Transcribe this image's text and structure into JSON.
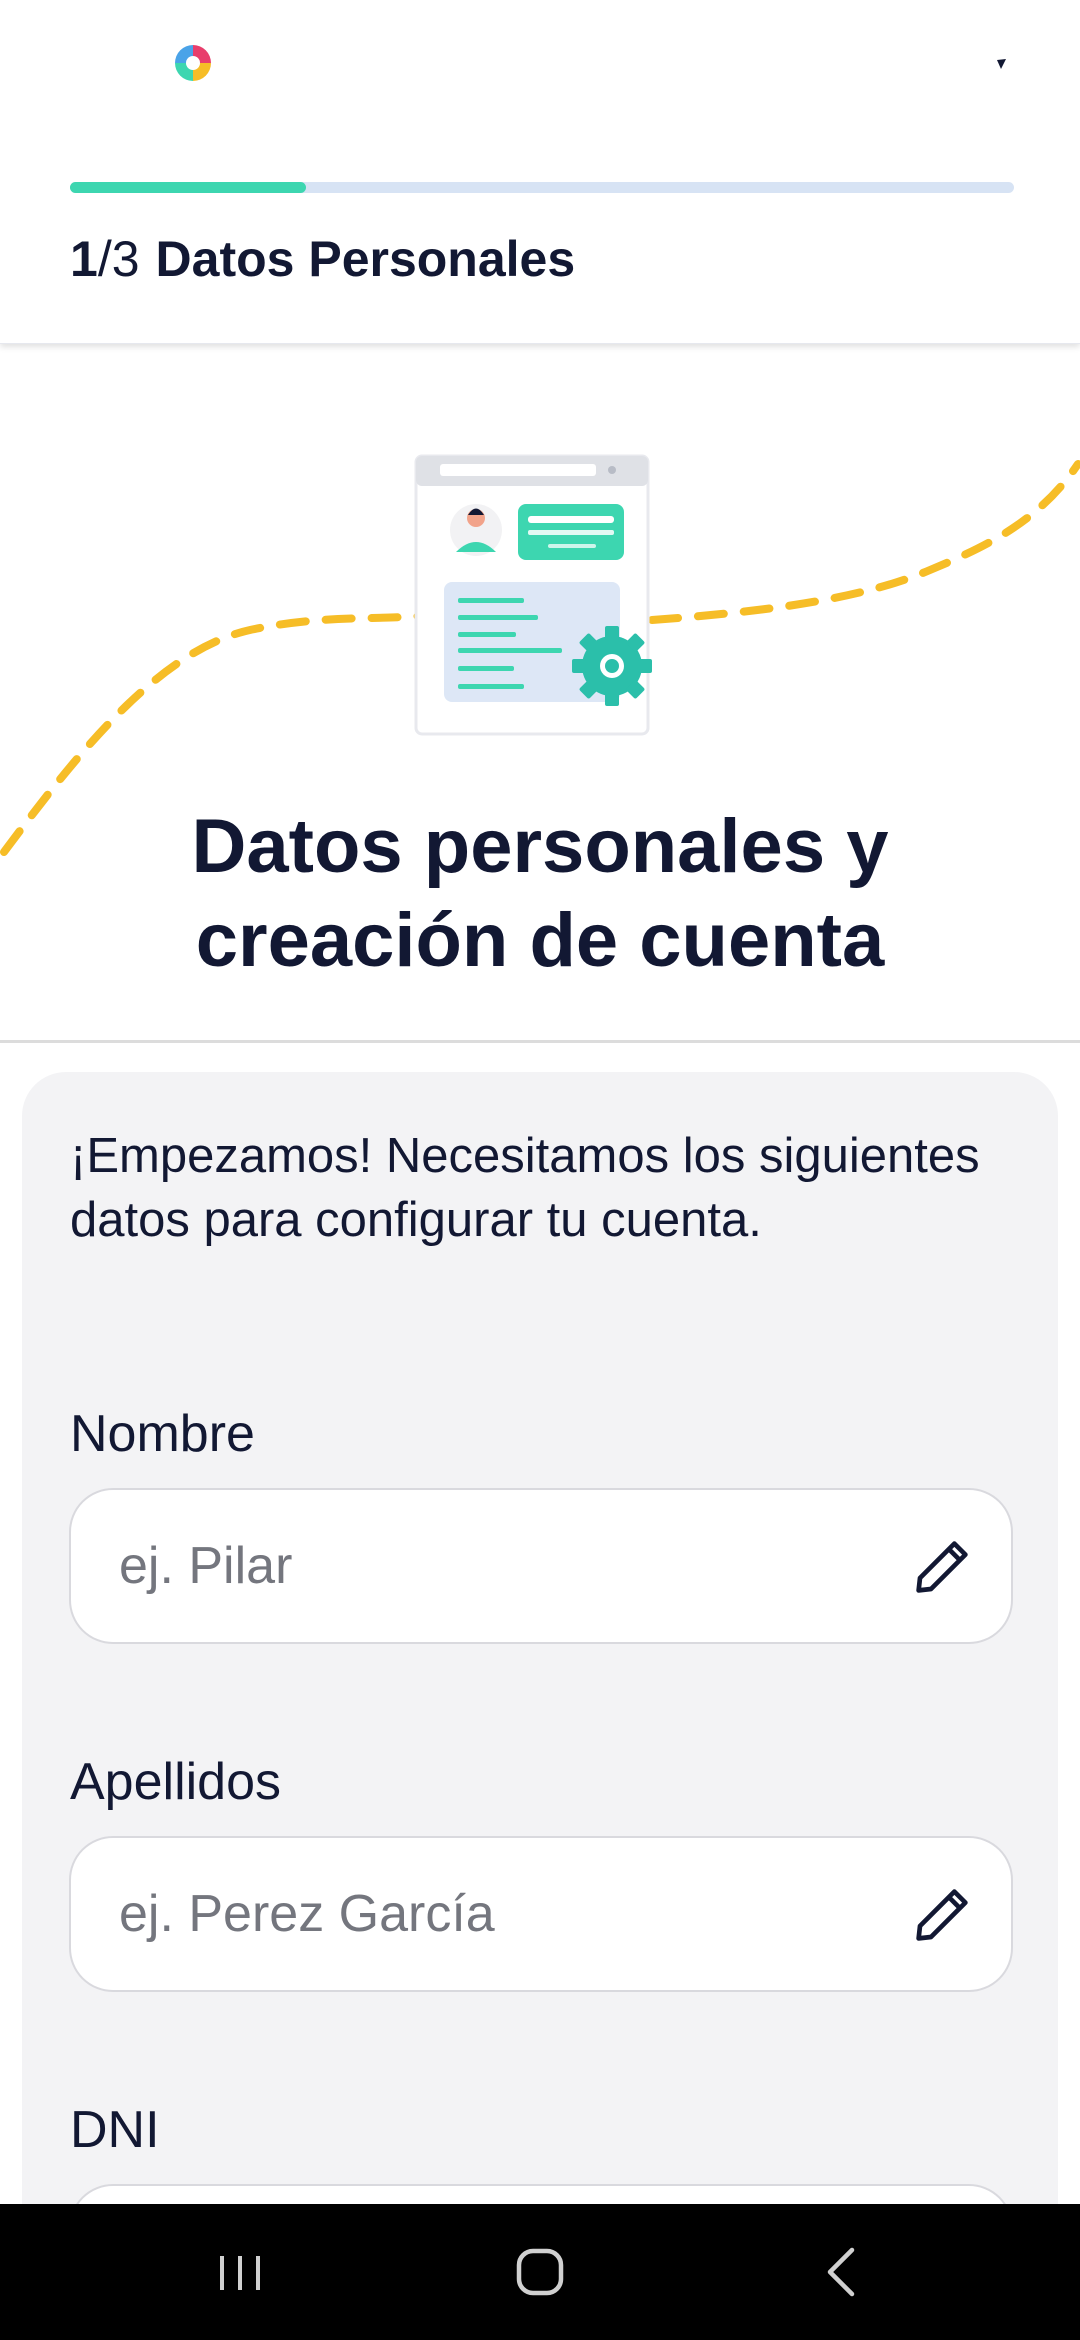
{
  "header": {
    "logo_icon": "app-logo-icon",
    "menu_icon": "more-icon",
    "progress": {
      "value": 0.25,
      "track_color": "#d7e3f4",
      "fill_color": "#3dd6b0"
    },
    "step": {
      "current": "1",
      "separator": "/",
      "total": "3",
      "title": "Datos Personales"
    }
  },
  "hero": {
    "illustration_icon": "id-card-gear-illustration",
    "wave_color": "#f6bd27",
    "title_line1": "Datos personales y",
    "title_line2": "creación de cuenta"
  },
  "form": {
    "intro": "¡Empezamos! Necesitamos los siguientes datos para configurar tu cuenta.",
    "fields": [
      {
        "label": "Nombre",
        "placeholder": "ej. Pilar",
        "value": "",
        "icon": "pencil-icon"
      },
      {
        "label": "Apellidos",
        "placeholder": "ej. Perez García",
        "value": "",
        "icon": "pencil-icon"
      },
      {
        "label": "DNI",
        "placeholder": "",
        "value": "",
        "icon": "pencil-icon"
      }
    ]
  },
  "navbar": {
    "recents_icon": "recents-icon",
    "home_icon": "home-icon",
    "back_icon": "back-icon"
  },
  "colors": {
    "text_dark": "#121833",
    "accent_teal": "#3dd6b0",
    "card_background": "#f3f3f5",
    "wave_yellow": "#f6bd27"
  }
}
